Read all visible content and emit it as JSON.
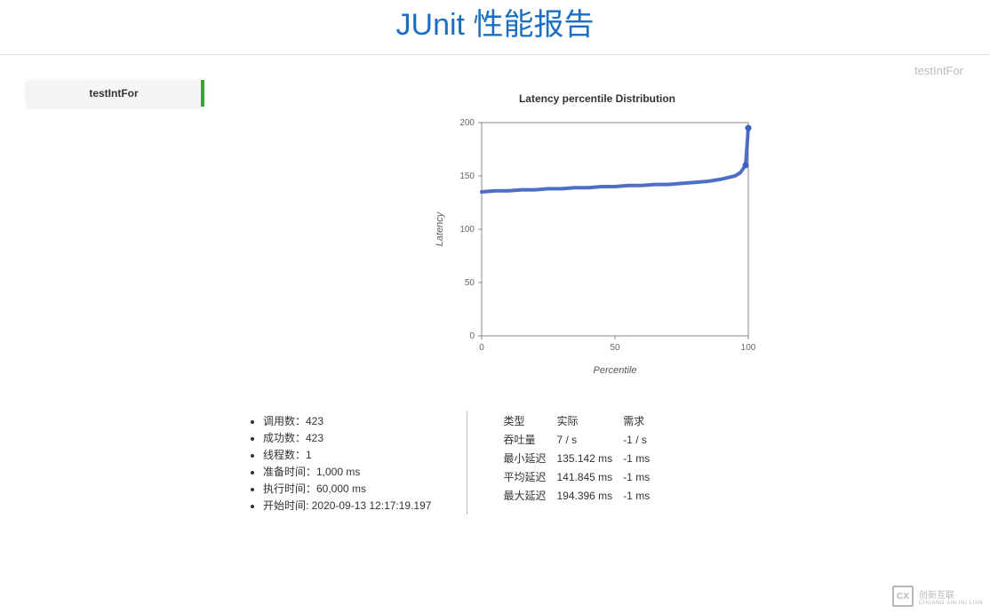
{
  "header": {
    "title": "JUnit 性能报告"
  },
  "sidebar": {
    "items": [
      {
        "label": "testIntFor"
      }
    ]
  },
  "main": {
    "current_test": "testIntFor"
  },
  "stats_left": [
    "调用数：423",
    "成功数：423",
    "线程数：1",
    "准备时间：1,000 ms",
    "执行时间：60,000 ms",
    "开始时间: 2020-09-13 12:17:19.197"
  ],
  "stats_right": {
    "headers": [
      "类型",
      "实际",
      "需求"
    ],
    "rows": [
      [
        "吞吐量",
        "7 / s",
        "-1 / s"
      ],
      [
        "最小延迟",
        "135.142 ms",
        "-1 ms"
      ],
      [
        "平均延迟",
        "141.845 ms",
        "-1 ms"
      ],
      [
        "最大延迟",
        "194.396 ms",
        "-1 ms"
      ]
    ]
  },
  "watermark": {
    "logo": "CX",
    "text1": "创新互联",
    "text2": "CHUANG XIN HU LIAN"
  },
  "chart_data": {
    "type": "line",
    "title": "Latency percentile Distribution",
    "xlabel": "Percentile",
    "ylabel": "Latency",
    "xlim": [
      0,
      100
    ],
    "ylim": [
      0,
      200
    ],
    "x_ticks": [
      0,
      50,
      100
    ],
    "y_ticks": [
      0,
      50,
      100,
      150,
      200
    ],
    "series": [
      {
        "name": "latency",
        "color": "#3b5fbf",
        "x": [
          0,
          5,
          10,
          15,
          20,
          25,
          30,
          35,
          40,
          45,
          50,
          55,
          60,
          65,
          70,
          75,
          80,
          85,
          90,
          95,
          97,
          99,
          100
        ],
        "values": [
          135,
          136,
          136,
          137,
          137,
          138,
          138,
          139,
          139,
          140,
          140,
          141,
          141,
          142,
          142,
          143,
          144,
          145,
          147,
          150,
          153,
          160,
          195
        ]
      }
    ]
  }
}
